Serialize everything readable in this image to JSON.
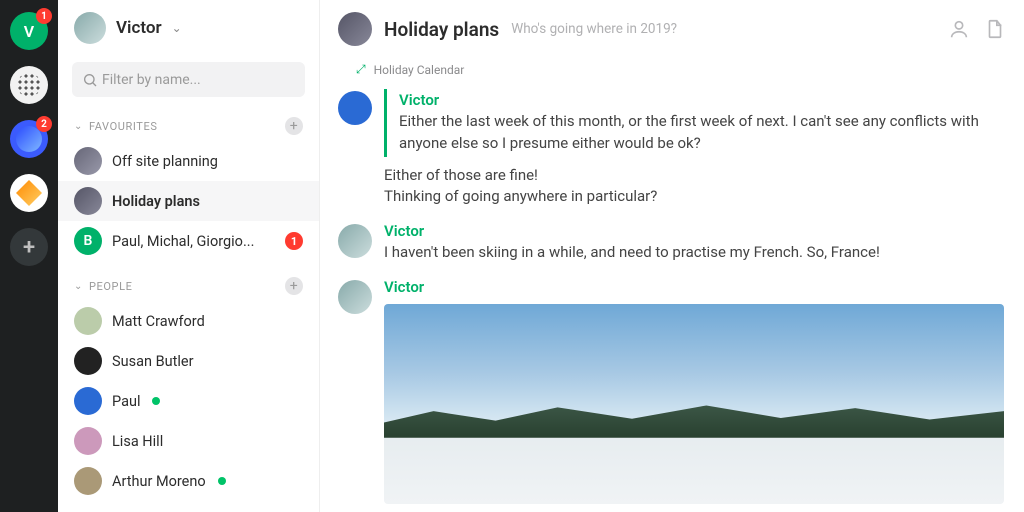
{
  "rail": {
    "workspace_initial": "V",
    "badges": {
      "workspace": "1",
      "blue": "2"
    }
  },
  "sidebar": {
    "user_name": "Victor",
    "filter_placeholder": "Filter by name...",
    "sections": {
      "favourites": {
        "label": "FAVOURITES",
        "items": [
          {
            "name": "Off site planning"
          },
          {
            "name": "Holiday plans",
            "active": true
          },
          {
            "name": "Paul, Michal, Giorgio...",
            "avatar_initial": "B",
            "badge": "1"
          }
        ]
      },
      "people": {
        "label": "PEOPLE",
        "items": [
          {
            "name": "Matt Crawford"
          },
          {
            "name": "Susan Butler"
          },
          {
            "name": "Paul",
            "online": true
          },
          {
            "name": "Lisa Hill"
          },
          {
            "name": "Arthur Moreno",
            "online": true
          }
        ]
      }
    }
  },
  "chat": {
    "title": "Holiday plans",
    "subtitle": "Who's going where in 2019?",
    "meta_label": "Holiday Calendar",
    "messages": [
      {
        "sender": "Victor",
        "quoted": true,
        "text": "Either the last week of this month, or the first week of next. I can't see any conflicts with anyone else so I presume either would be ok?"
      },
      {
        "plain": true,
        "text1": "Either of those are fine!",
        "text2": "Thinking of going anywhere in particular?"
      },
      {
        "sender": "Victor",
        "text": "I haven't been skiing in a while, and need to practise my French. So, France!"
      },
      {
        "sender": "Victor",
        "image": true
      }
    ]
  }
}
